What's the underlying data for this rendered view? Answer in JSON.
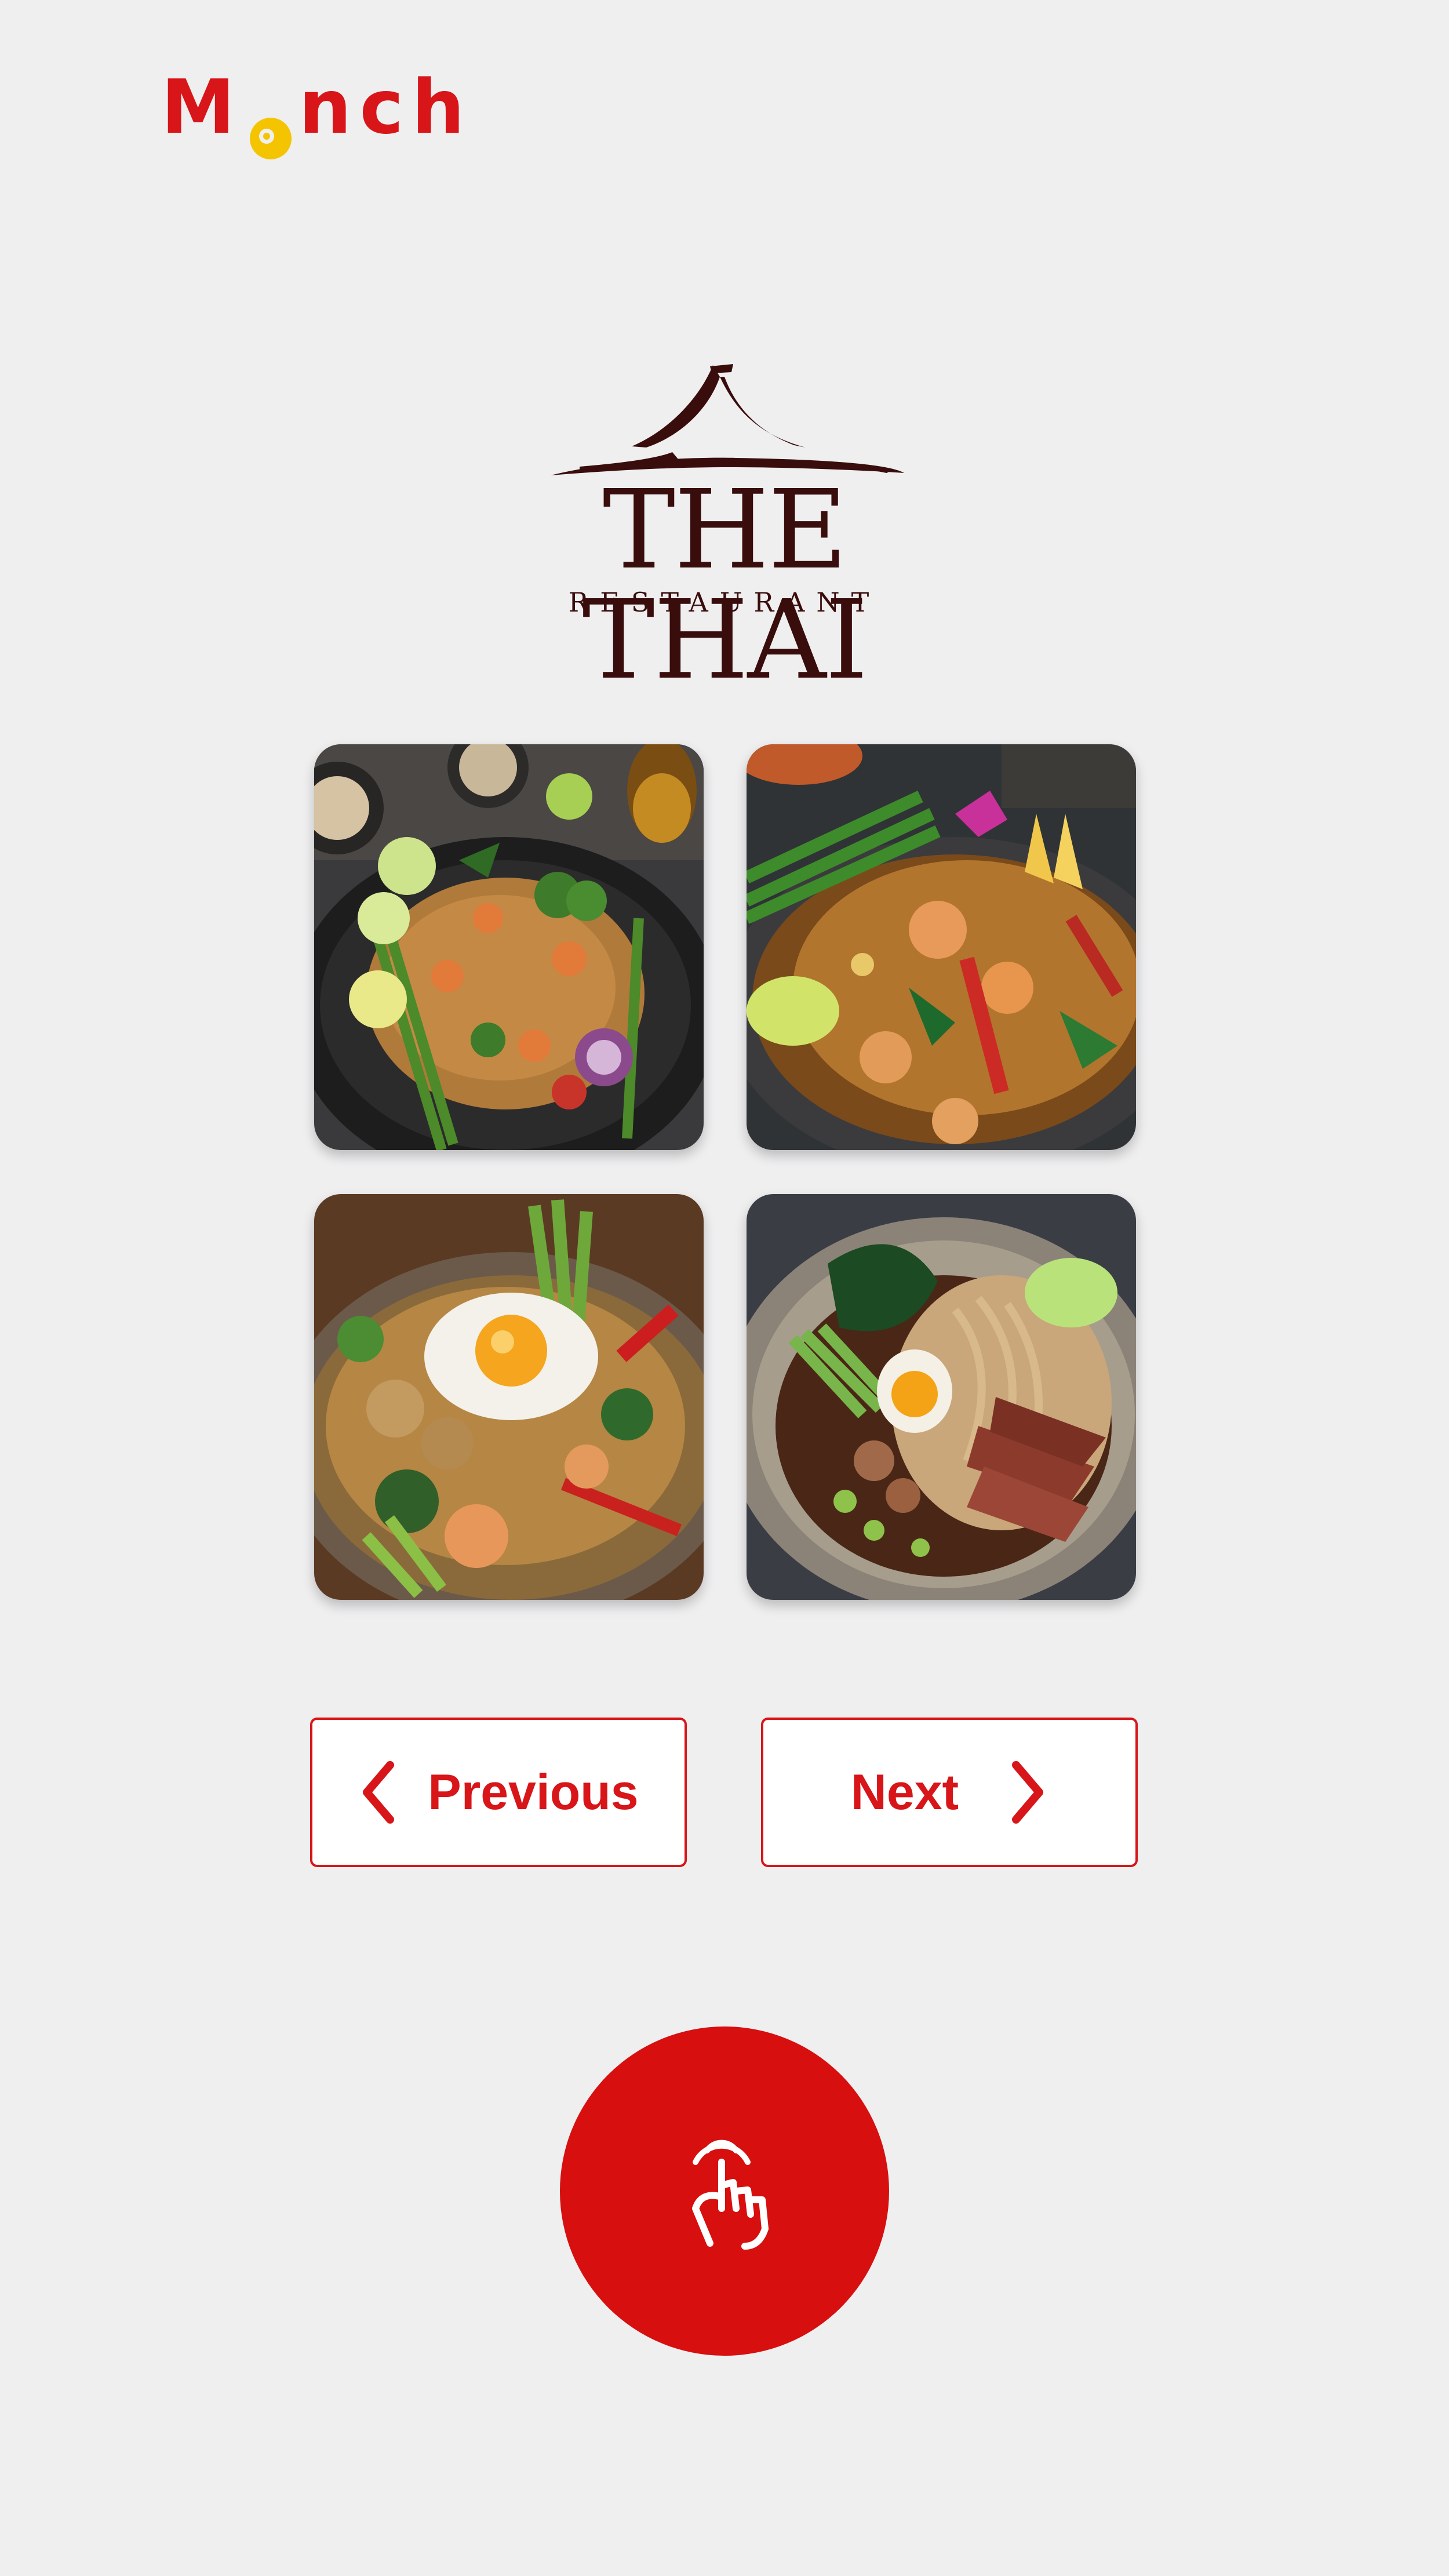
{
  "app": {
    "brand_name": "Monch",
    "brand_prefix": "M",
    "brand_suffix": "nch",
    "brand_color": "#d81518",
    "brand_accent": "#f5c400"
  },
  "restaurant": {
    "name": "THE THAI",
    "subtitle": "RESTAURANT",
    "logo_color": "#3a0d0d"
  },
  "gallery": {
    "items": [
      {
        "icon": "pad-thai-shrimp-dish-image"
      },
      {
        "icon": "stir-fried-noodles-shrimp-image"
      },
      {
        "icon": "fried-egg-noodle-dish-image"
      },
      {
        "icon": "noodle-soup-bowl-image"
      }
    ]
  },
  "navigation": {
    "previous_label": "Previous",
    "next_label": "Next",
    "accent": "#d81518"
  },
  "tap_button": {
    "icon": "tap-hand-icon",
    "color": "#d70f0f"
  }
}
